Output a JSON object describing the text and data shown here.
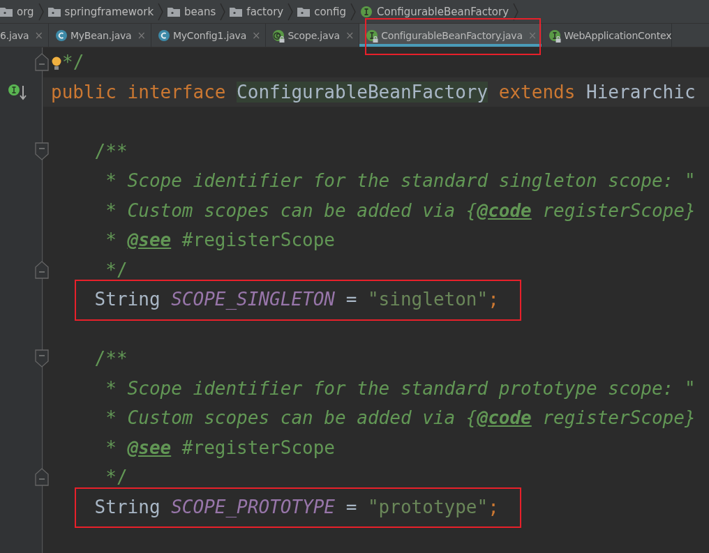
{
  "breadcrumbs": [
    {
      "label": "org",
      "kind": "folder"
    },
    {
      "label": "springframework",
      "kind": "folder"
    },
    {
      "label": "beans",
      "kind": "folder"
    },
    {
      "label": "factory",
      "kind": "folder"
    },
    {
      "label": "config",
      "kind": "folder"
    },
    {
      "label": "ConfigurableBeanFactory",
      "kind": "interface"
    }
  ],
  "tabs": [
    {
      "label": "6.java",
      "selected": false
    },
    {
      "label": "MyBean.java",
      "kind": "class",
      "selected": false
    },
    {
      "label": "MyConfig1.java",
      "kind": "class",
      "selected": false
    },
    {
      "label": "Scope.java",
      "kind": "annotation",
      "locked": true,
      "selected": false
    },
    {
      "label": "ConfigurableBeanFactory.java",
      "kind": "interface",
      "locked": true,
      "selected": true,
      "highlighted": true
    },
    {
      "label": "WebApplicationContex",
      "kind": "interface",
      "locked": true,
      "selected": false
    }
  ],
  "tab_close": "×",
  "lines": [
    {
      "fold_end": true,
      "bulb": true,
      "tokens": [
        {
          "kind": "doc",
          "text": "*/"
        }
      ]
    },
    {
      "implemented": true,
      "current": true,
      "tokens": [
        {
          "kind": "keyword",
          "text": "public interface "
        },
        {
          "kind": "decl",
          "text": "ConfigurableBeanFactory"
        },
        {
          "kind": "keyword",
          "text": " extends "
        },
        {
          "kind": "plain",
          "text": "Hierarchic"
        }
      ]
    },
    {
      "kind": "blank"
    },
    {
      "fold_start": true,
      "tokens": [
        {
          "kind": "doc",
          "text": "    /**"
        }
      ]
    },
    {
      "tokens": [
        {
          "kind": "doc",
          "text": "     * "
        },
        {
          "kind": "doc-italic",
          "text": "Scope identifier for the standard singleton scope: \""
        }
      ]
    },
    {
      "tokens": [
        {
          "kind": "doc",
          "text": "     * "
        },
        {
          "kind": "doc-italic",
          "text": "Custom scopes can be added via {"
        },
        {
          "kind": "doc-tag",
          "text": "@code"
        },
        {
          "kind": "doc-italic",
          "text": " registerScope}"
        }
      ]
    },
    {
      "tokens": [
        {
          "kind": "doc",
          "text": "     * "
        },
        {
          "kind": "doc-tag",
          "text": "@see"
        },
        {
          "kind": "doc",
          "text": " #registerScope"
        }
      ]
    },
    {
      "fold_end": true,
      "tokens": [
        {
          "kind": "doc",
          "text": "     */"
        }
      ]
    },
    {
      "highlighted": true,
      "tokens": [
        {
          "kind": "plain",
          "text": "    String "
        },
        {
          "kind": "constant",
          "text": "SCOPE_SINGLETON"
        },
        {
          "kind": "plain",
          "text": " = "
        },
        {
          "kind": "string",
          "text": "\"singleton\""
        },
        {
          "kind": "keyword",
          "text": ";"
        }
      ]
    },
    {
      "kind": "blank"
    },
    {
      "fold_start": true,
      "tokens": [
        {
          "kind": "doc",
          "text": "    /**"
        }
      ]
    },
    {
      "tokens": [
        {
          "kind": "doc",
          "text": "     * "
        },
        {
          "kind": "doc-italic",
          "text": "Scope identifier for the standard prototype scope: \""
        }
      ]
    },
    {
      "tokens": [
        {
          "kind": "doc",
          "text": "     * "
        },
        {
          "kind": "doc-italic",
          "text": "Custom scopes can be added via {"
        },
        {
          "kind": "doc-tag",
          "text": "@code"
        },
        {
          "kind": "doc-italic",
          "text": " registerScope}"
        }
      ]
    },
    {
      "tokens": [
        {
          "kind": "doc",
          "text": "     * "
        },
        {
          "kind": "doc-tag",
          "text": "@see"
        },
        {
          "kind": "doc",
          "text": " #registerScope"
        }
      ]
    },
    {
      "fold_end": true,
      "tokens": [
        {
          "kind": "doc",
          "text": "     */"
        }
      ]
    },
    {
      "highlighted": true,
      "tokens": [
        {
          "kind": "plain",
          "text": "    String "
        },
        {
          "kind": "constant",
          "text": "SCOPE_PROTOTYPE"
        },
        {
          "kind": "plain",
          "text": " = "
        },
        {
          "kind": "string",
          "text": "\"prototype\""
        },
        {
          "kind": "keyword",
          "text": ";"
        }
      ]
    }
  ]
}
